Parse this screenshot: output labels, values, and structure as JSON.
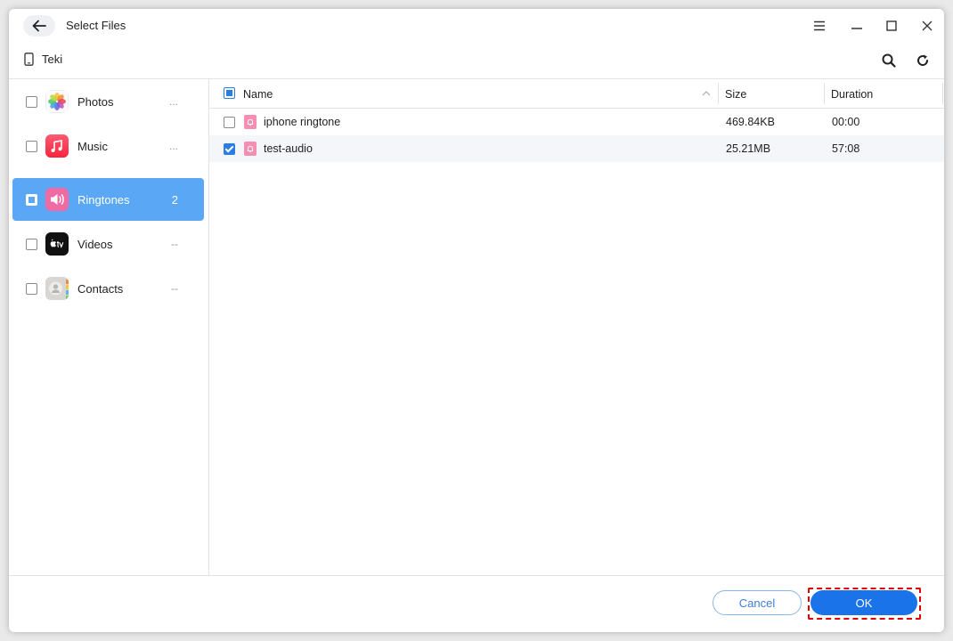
{
  "window": {
    "title": "Select Files"
  },
  "device": {
    "name": "Teki"
  },
  "sidebar": {
    "items": [
      {
        "label": "Photos",
        "count": "...",
        "checkbox": "unchecked",
        "active": false
      },
      {
        "label": "Music",
        "count": "...",
        "checkbox": "unchecked",
        "active": false
      },
      {
        "label": "Ringtones",
        "count": "2",
        "checkbox": "partial",
        "active": true
      },
      {
        "label": "Videos",
        "count": "--",
        "checkbox": "unchecked",
        "active": false
      },
      {
        "label": "Contacts",
        "count": "--",
        "checkbox": "unchecked",
        "active": false
      }
    ]
  },
  "table": {
    "header_checkbox": "partial",
    "columns": {
      "name": "Name",
      "size": "Size",
      "duration": "Duration"
    },
    "rows": [
      {
        "name": "iphone ringtone",
        "size": "469.84KB",
        "duration": "00:00",
        "checked": false
      },
      {
        "name": "test-audio",
        "size": "25.21MB",
        "duration": "57:08",
        "checked": true
      }
    ]
  },
  "footer": {
    "cancel_label": "Cancel",
    "ok_label": "OK"
  },
  "colors": {
    "accent": "#1a73e8",
    "active_item": "#5aa8f5",
    "highlight": "#e00000"
  }
}
